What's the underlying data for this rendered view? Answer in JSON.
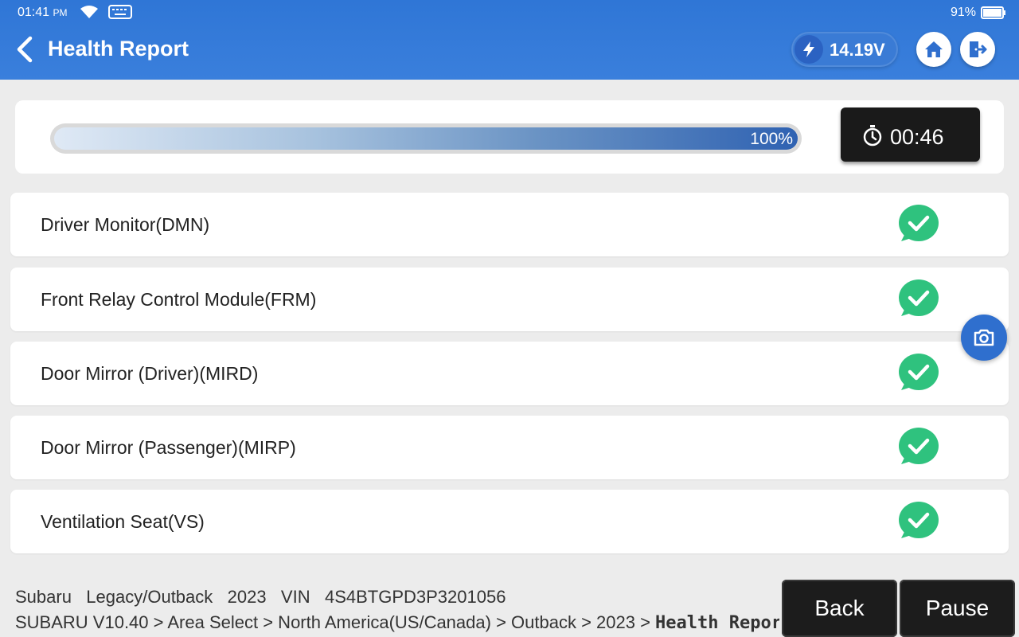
{
  "status_bar": {
    "time": "01:41",
    "ampm": "PM",
    "battery": "91%"
  },
  "header": {
    "title": "Health Report",
    "voltage": "14.19V"
  },
  "progress": {
    "percent": 100,
    "label": "100%",
    "timer": "00:46"
  },
  "modules": [
    {
      "label": "Driver Monitor(DMN)",
      "status": "ok"
    },
    {
      "label": "Front Relay Control Module(FRM)",
      "status": "ok"
    },
    {
      "label": "Door Mirror (Driver)(MIRD)",
      "status": "ok"
    },
    {
      "label": "Door Mirror (Passenger)(MIRP)",
      "status": "ok"
    },
    {
      "label": "Ventilation Seat(VS)",
      "status": "ok"
    }
  ],
  "footer": {
    "make": "Subaru",
    "model": "Legacy/Outback",
    "year": "2023",
    "vin_label": "VIN",
    "vin": "4S4BTGPD3P3201056",
    "path": "SUBARU V10.40 > Area Select > North America(US/Canada) > Outback > 2023 > ",
    "path_current": "Health Report",
    "back_label": "Back",
    "pause_label": "Pause"
  },
  "colors": {
    "header_blue": "#2f76d6",
    "check_green": "#2fc27e",
    "button_dark": "#1c1c1c"
  }
}
